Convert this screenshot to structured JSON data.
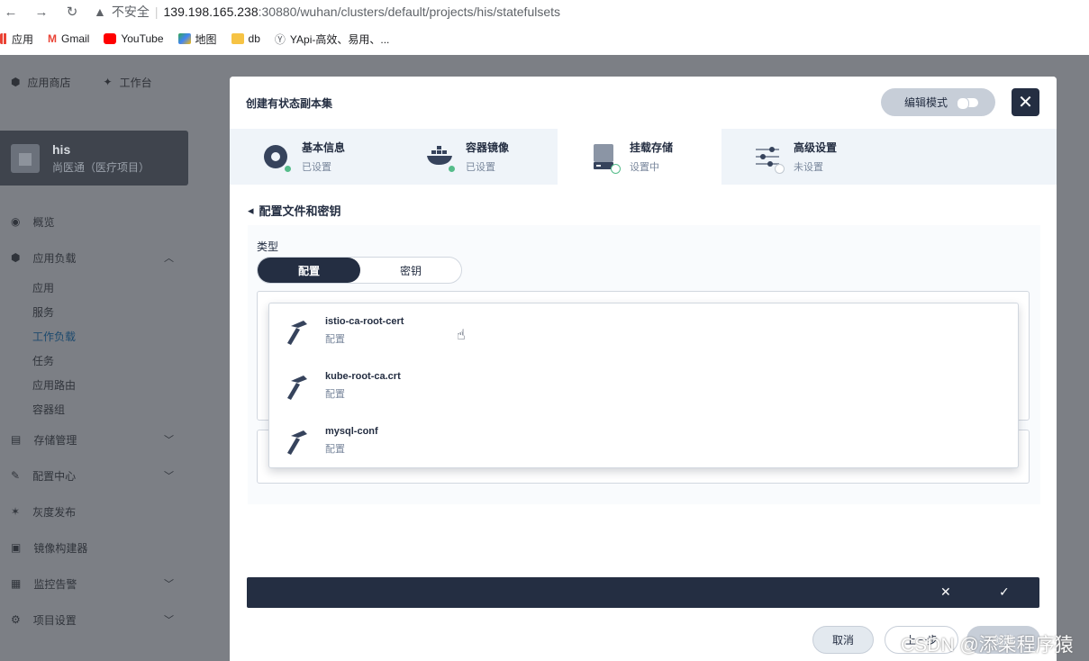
{
  "browser": {
    "insecure_label": "不安全",
    "url_host": "139.198.165.238",
    "url_rest": ":30880/wuhan/clusters/default/projects/his/statefulsets",
    "bookmarks": [
      "应用",
      "Gmail",
      "YouTube",
      "地图",
      "db",
      "YApi-高效、易用、..."
    ]
  },
  "topbar": {
    "app_store": "应用商店",
    "workbench": "工作台"
  },
  "project": {
    "name": "his",
    "desc": "尚医通（医疗项目）"
  },
  "sidebar": {
    "overview": "概览",
    "workloads": "应用负载",
    "sub": [
      "应用",
      "服务",
      "工作负载",
      "任务",
      "应用路由",
      "容器组"
    ],
    "storage": "存储管理",
    "config": "配置中心",
    "gray": "灰度发布",
    "image_builder": "镜像构建器",
    "monitoring": "监控告警",
    "project_settings": "项目设置"
  },
  "modal": {
    "title": "创建有状态副本集",
    "edit_mode": "编辑模式",
    "steps": [
      {
        "title": "基本信息",
        "status": "已设置"
      },
      {
        "title": "容器镜像",
        "status": "已设置"
      },
      {
        "title": "挂载存储",
        "status": "设置中"
      },
      {
        "title": "高级设置",
        "status": "未设置"
      }
    ],
    "section_title": "配置文件和密钥",
    "type_label": "类型",
    "type_options": [
      "配置",
      "密钥"
    ],
    "dropdown": [
      {
        "name": "istio-ca-root-cert",
        "type": "配置"
      },
      {
        "name": "kube-root-ca.crt",
        "type": "配置"
      },
      {
        "name": "mysql-conf",
        "type": "配置"
      }
    ],
    "footer": {
      "cancel": "取消",
      "prev": "上一步",
      "create": "创建"
    }
  },
  "watermark": "CSDN @添柒程序猿",
  "colors": {
    "accent": "#242e42",
    "success": "#55bc8a",
    "overlay": "#7c7f85"
  }
}
